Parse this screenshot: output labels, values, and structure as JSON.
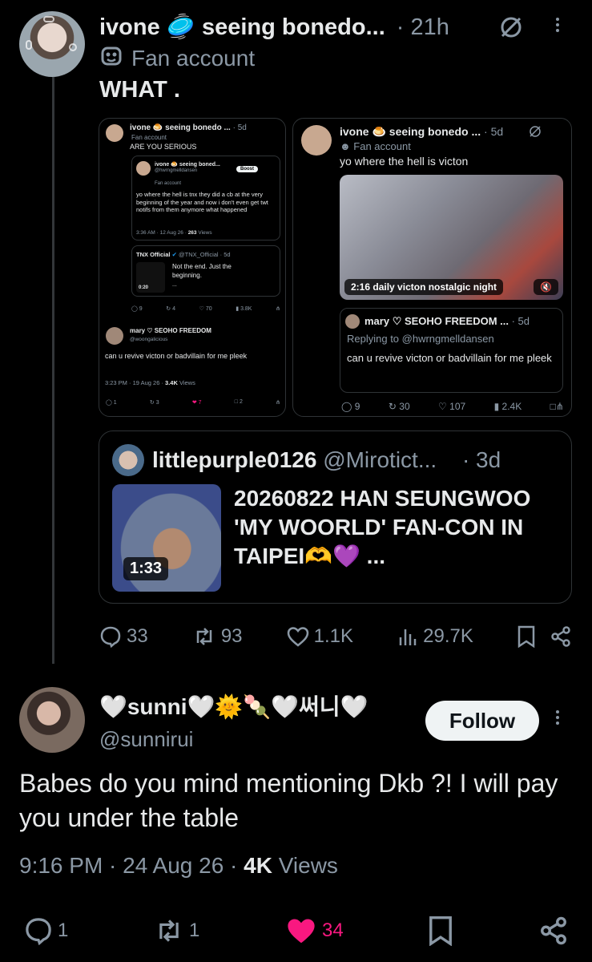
{
  "colors": {
    "bg": "#000000",
    "text": "#e7e9ea",
    "muted": "#8b98a5",
    "like": "#f91880",
    "verified": "#1d9bf0",
    "border": "#2f3336"
  },
  "main_post": {
    "author": "ivone 🥏 seeing bonedo...",
    "time": "· 21h",
    "label": "Fan account",
    "label_icon": "mask-icon",
    "text": "WHAT .",
    "stats": {
      "replies": "33",
      "reposts": "93",
      "likes": "1.1K",
      "views": "29.7K"
    }
  },
  "left_screenshot": {
    "author": "ivone 🍮 seeing bonedo ...",
    "time": "· 5d",
    "label": "Fan account",
    "text": "ARE YOU SERIOUS",
    "inner_quote": {
      "author": "ivone 🍮 seeing boned...",
      "handle": "@hwrngmelldansen",
      "boost_label": "Boost",
      "label": "Fan account",
      "text": "yo where the hell is tnx they did a cb at the very beginning of the year and now i don't even get twt notifs from them anymore what happened",
      "meta_time": "3:36 AM · 12 Aug 26 · ",
      "meta_views_num": "263",
      "meta_views_label": " Views"
    },
    "tnx_quote": {
      "author": "TNX Official",
      "handle": "@TNX_Official · 5d",
      "text": "Not the end. Just the beginning.",
      "ellipsis": "...",
      "duration": "0:20"
    },
    "stats": {
      "replies": "9",
      "reposts": "4",
      "likes": "70",
      "views": "3.8K"
    },
    "reply": {
      "author": "mary ♡ SEOHO FREEDOM",
      "handle": "@woongalicious",
      "text": "can u revive victon or badvillain for me pleek",
      "meta_time": "3:23 PM · 19 Aug 26 · ",
      "meta_views_num": "3.4K",
      "meta_views_label": " Views"
    },
    "reply_stats": {
      "replies": "1",
      "reposts": "3",
      "likes": "7",
      "bookmarks": "2"
    }
  },
  "right_screenshot": {
    "author": "ivone 🍮 seeing bonedo ...",
    "time": "· 5d",
    "label": "Fan account",
    "text": "yo where the hell is victon",
    "video_duration": "2:16",
    "video_title": "daily victon nostalgic night",
    "reply": {
      "author": "mary ♡ SEOHO FREEDOM ...",
      "time": "· 5d",
      "replying": "Replying to @hwrngmelldansen",
      "text": "can u revive victon or badvillain for me pleek"
    },
    "stats": {
      "replies": "9",
      "reposts": "30",
      "likes": "107",
      "views": "2.4K"
    }
  },
  "quoted_post": {
    "author": "littlepurple0126",
    "handle": "@Mirotict...",
    "time": "· 3d",
    "text": "20260822 HAN SEUNGWOO 'MY WOORLD' FAN-CON IN TAIPEI🫶💜 ...",
    "video_duration": "1:33"
  },
  "reply_post": {
    "author": "🤍sunni🤍🌞🍡🤍써니🤍",
    "handle": "@sunnirui",
    "follow_label": "Follow",
    "text": "Babes do you mind mentioning Dkb ?! I will pay you under the table",
    "meta_time": "9:16 PM · 24 Aug 26 · ",
    "meta_views_num": "4K",
    "meta_views_label": " Views",
    "stats": {
      "replies": "1",
      "reposts": "1",
      "likes": "34"
    }
  }
}
